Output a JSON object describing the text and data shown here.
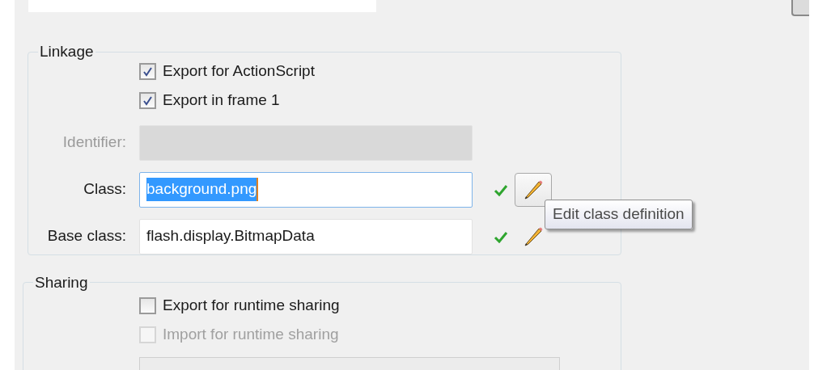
{
  "linkage": {
    "title": "Linkage",
    "options": [
      {
        "label": "Export for ActionScript",
        "checked": true,
        "disabled": false
      },
      {
        "label": "Export in frame 1",
        "checked": true,
        "disabled": false
      }
    ],
    "fields": [
      {
        "label": "Identifier:",
        "disabled": true,
        "focused": false
      },
      {
        "label": "Class:",
        "value": "background.png",
        "disabled": false,
        "focused": true,
        "text_selected": true,
        "valid": true,
        "edit_hovered": true
      },
      {
        "label": "Base class:",
        "value": "flash.display.BitmapData",
        "disabled": false,
        "focused": false,
        "valid": true,
        "edit_hovered": false
      }
    ]
  },
  "tooltip": "Edit class definition",
  "sharing": {
    "title": "Sharing",
    "options": [
      {
        "label": "Export for runtime sharing",
        "checked": false,
        "disabled": false
      },
      {
        "label": "Import for runtime sharing",
        "checked": false,
        "disabled": true
      }
    ]
  }
}
